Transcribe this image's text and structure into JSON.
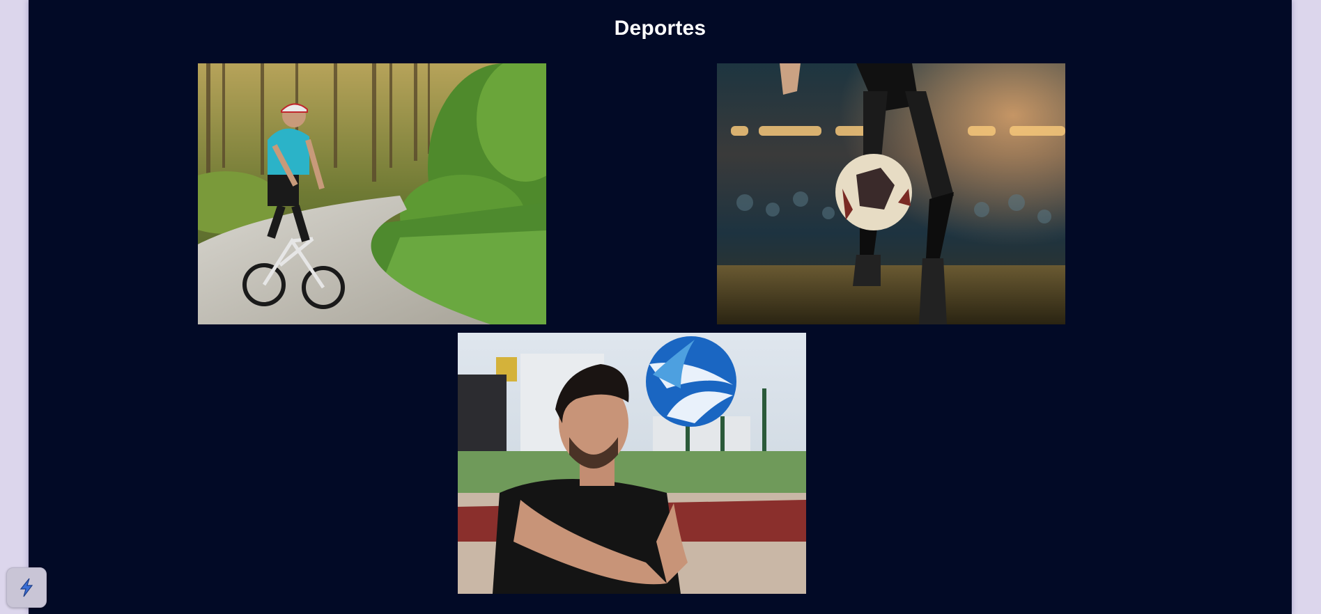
{
  "page": {
    "title": "Deportes"
  },
  "gallery": {
    "items": [
      {
        "icon": "cyclist-photo"
      },
      {
        "icon": "soccer-photo"
      },
      {
        "icon": "volleyball-photo"
      }
    ]
  },
  "widget": {
    "icon": "lightning-icon"
  },
  "colors": {
    "page_background": "#dcd6ec",
    "panel_background": "#020a26",
    "title_color": "#ffffff",
    "widget_accent": "#3b6fd6"
  }
}
